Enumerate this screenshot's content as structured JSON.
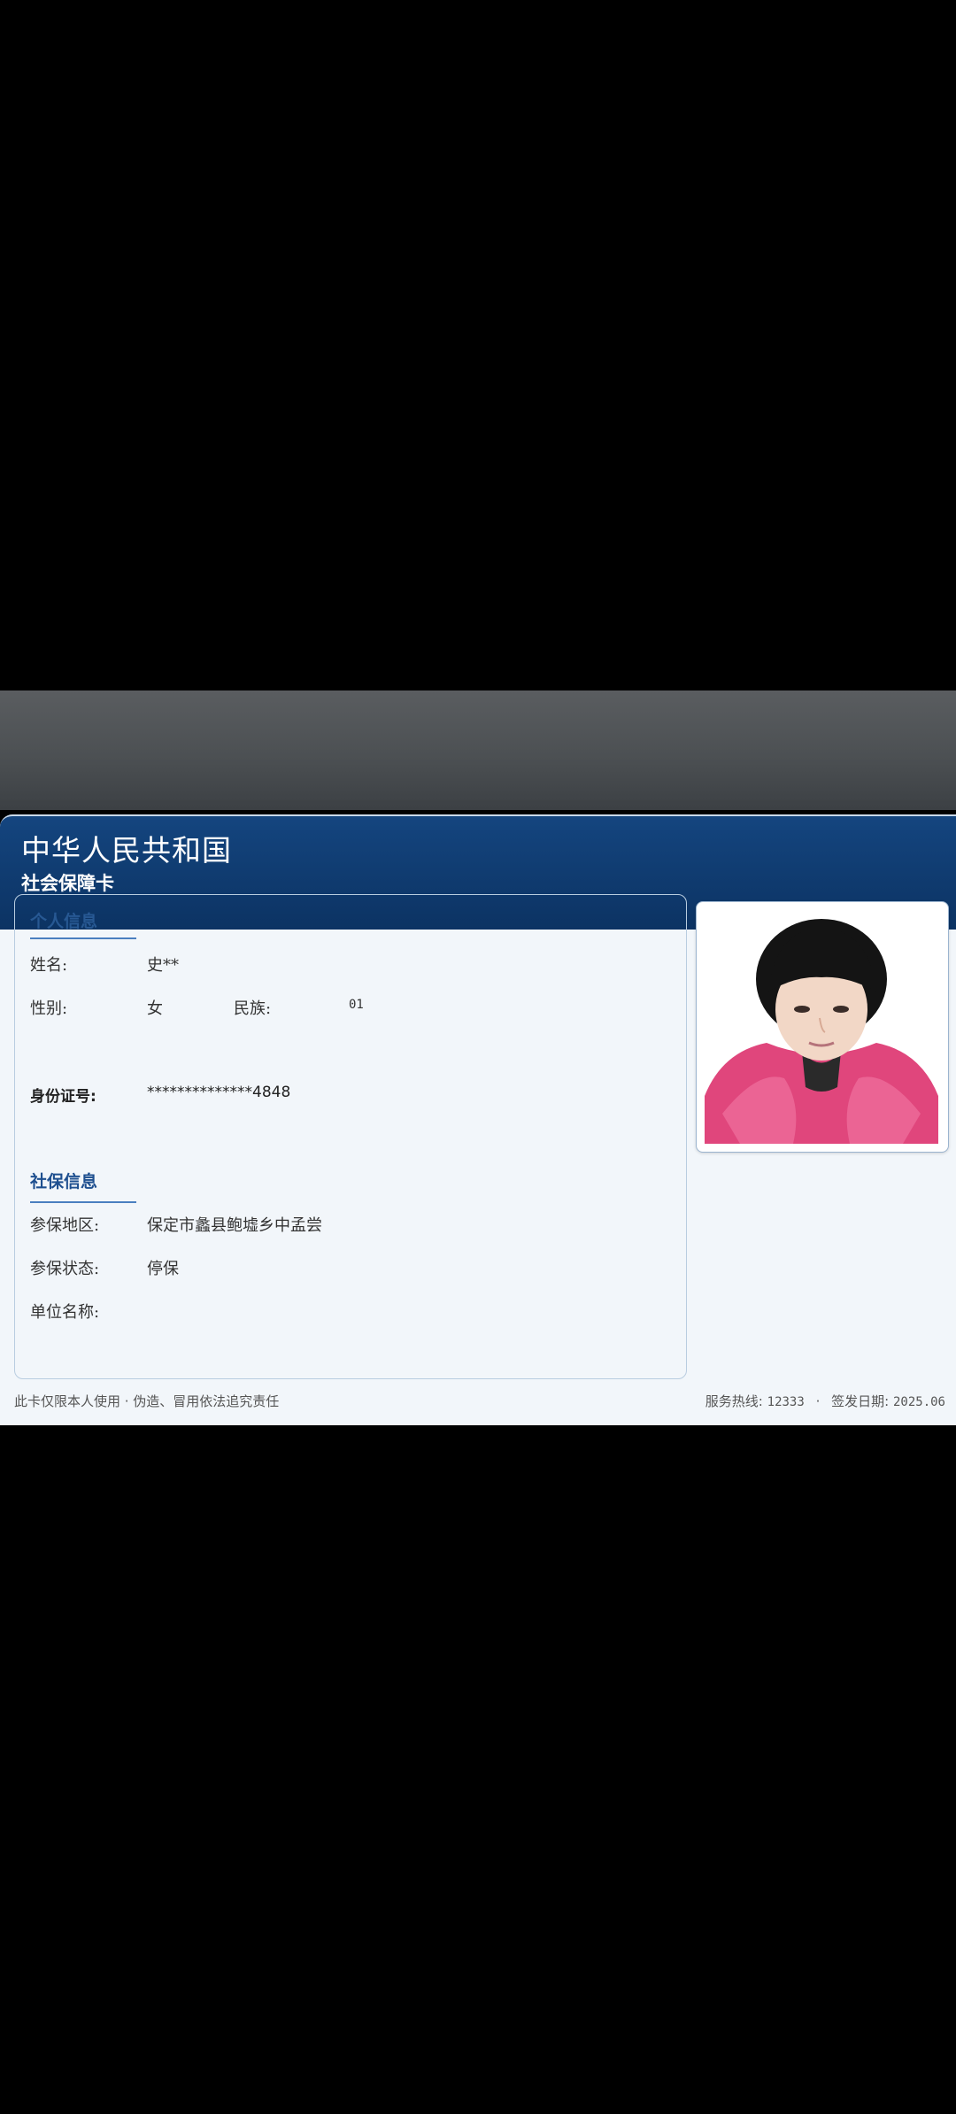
{
  "card": {
    "title": "中华人民共和国",
    "subtitle": "社会保障卡"
  },
  "personal_section": {
    "title": "个人信息",
    "name_label": "姓名:",
    "name_value": "史**",
    "gender_label": "性别:",
    "gender_value": "女",
    "ethnicity_label": "民族:",
    "ethnicity_value": "01",
    "id_label": "身份证号:",
    "id_value": "**************4848"
  },
  "social_section": {
    "title": "社保信息",
    "region_label": "参保地区:",
    "region_value": "保定市蠡县鲍墟乡中孟尝",
    "status_label": "参保状态:",
    "status_value": "停保",
    "employer_label": "单位名称:",
    "employer_value": ""
  },
  "footer": {
    "notice": "此卡仅限本人使用 · 伪造、冒用依法追究责任",
    "hotline_label": "服务热线:",
    "hotline_value": "12333",
    "separator": "·",
    "issue_label": "签发日期:",
    "issue_value": "2025.06"
  },
  "colors": {
    "header_bg": "#0f3a6e",
    "card_bg": "#f2f6fa",
    "accent": "#1e4f8f",
    "photo_jacket": "#e0467c"
  },
  "icons": {
    "photo": "portrait-photo"
  }
}
